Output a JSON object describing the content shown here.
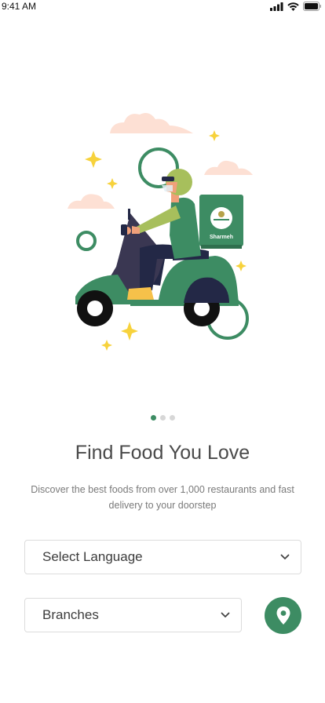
{
  "status_bar": {
    "time": "9:41 AM"
  },
  "illustration": {
    "box_brand_text": "Sharmeh"
  },
  "onboarding": {
    "page_count": 3,
    "active_page": 1,
    "title": "Find Food You Love",
    "subtitle": "Discover the best foods from over 1,000 restaurants and fast delivery to your doorstep"
  },
  "language_select": {
    "placeholder": "Select Language"
  },
  "branches_select": {
    "placeholder": "Branches"
  },
  "colors": {
    "accent": "#3d8c63",
    "text_primary": "#4a4a4a",
    "text_secondary": "#7a7a7a",
    "sparkle": "#f7d23c"
  },
  "icons": {
    "location_button": "location-pin-icon",
    "select_arrow": "chevron-down-icon"
  }
}
